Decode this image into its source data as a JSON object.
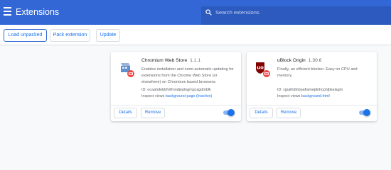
{
  "header": {
    "title": "Extensions",
    "search_placeholder": "Search extensions"
  },
  "toolbar": {
    "load_unpacked": "Load unpacked",
    "pack_extension": "Pack extension",
    "update": "Update"
  },
  "extensions": [
    {
      "name": "Chromium Web Store",
      "version": "1.1.1",
      "description": "Enables installation and semi-automatic updating for extensions from the Chrome Web Store (or elsewhere) on Chromium based browsers.",
      "id_line": "ID: ocaahdebbfolfmndjeplogmgcagdmblk",
      "inspect_prefix": "Inspect views",
      "inspect_link": "background page (Inactive)",
      "details_label": "Details",
      "remove_label": "Remove",
      "enabled": true,
      "icon": "chromium-web-store-icon"
    },
    {
      "name": "uBlock Origin",
      "version": "1.30.6",
      "description": "Finally, an efficient blocker. Easy on CPU and memory.",
      "id_line": "ID: cjpalhdlnbpafiamejdnhcphjbkeiagm",
      "inspect_prefix": "Inspect views",
      "inspect_link": "background.html",
      "details_label": "Details",
      "remove_label": "Remove",
      "enabled": true,
      "icon": "ublock-origin-icon"
    }
  ],
  "colors": {
    "header_bg": "#3367d6",
    "accent": "#1a73e8",
    "toggle_track": "#8ab4f8",
    "ublock_red": "#800000",
    "badge_red": "#e44"
  }
}
